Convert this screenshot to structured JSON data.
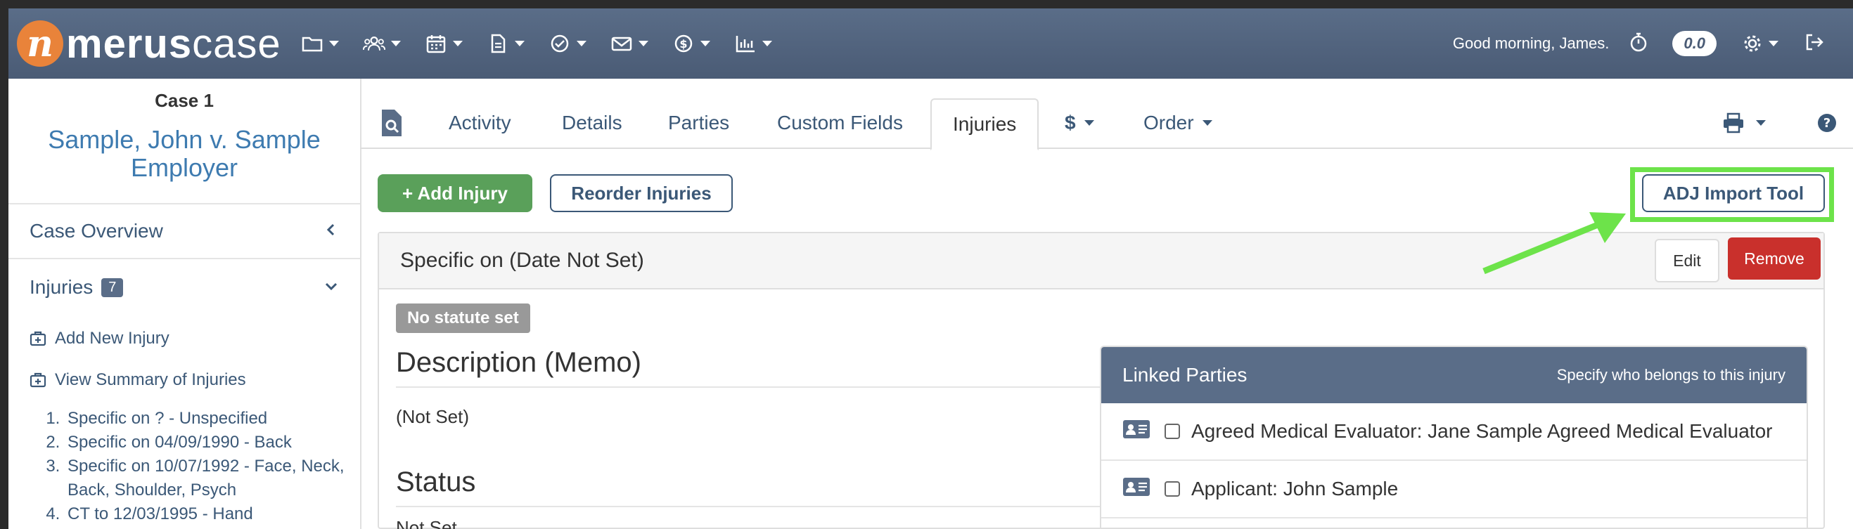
{
  "app": {
    "logo_text_bold": "merus",
    "logo_text_light": "case",
    "logo_mark": "n"
  },
  "topbar": {
    "icons": [
      "folder-icon",
      "users-icon",
      "calendar-icon",
      "document-icon",
      "check-circle-icon",
      "envelope-icon",
      "dollar-icon",
      "bar-chart-icon"
    ],
    "greeting": "Good morning, James.",
    "timer_value": "0.0"
  },
  "sidebar": {
    "case_label": "Case 1",
    "case_title": "Sample, John v. Sample Employer",
    "case_overview": "Case Overview",
    "injuries_label": "Injuries",
    "injuries_count": "7",
    "add_new_injury": "Add New Injury",
    "view_summary": "View Summary of Injuries",
    "injury_items": [
      "Specific on ? - Unspecified",
      "Specific on 04/09/1990 - Back",
      "Specific on 10/07/1992 - Face, Neck, Back, Shoulder, Psych",
      "CT to 12/03/1995 - Hand"
    ]
  },
  "tabs": {
    "activity": "Activity",
    "details": "Details",
    "parties": "Parties",
    "custom_fields": "Custom Fields",
    "injuries": "Injuries",
    "money": "$",
    "order": "Order"
  },
  "toolbar": {
    "add_injury": "+  Add Injury",
    "reorder": "Reorder Injuries",
    "adj_import": "ADJ Import Tool"
  },
  "injury": {
    "header": "Specific on (Date Not Set)",
    "edit": "Edit",
    "remove": "Remove",
    "statute_badge": "No statute set",
    "description_title": "Description (Memo)",
    "description_value": "(Not Set)",
    "status_title": "Status",
    "status_value": "Not Set"
  },
  "linked_parties": {
    "title": "Linked Parties",
    "subtitle": "Specify who belongs to this injury",
    "rows": [
      "Agreed Medical Evaluator: Jane Sample Agreed Medical Evaluator",
      "Applicant: John Sample"
    ]
  },
  "colors": {
    "nav_bg": "#4a5b75",
    "accent_blue": "#3e7bb0",
    "add_green": "#5aa05a",
    "remove_red": "#c9302c",
    "highlight_green": "#6de34a",
    "logo_orange": "#e9833a"
  }
}
